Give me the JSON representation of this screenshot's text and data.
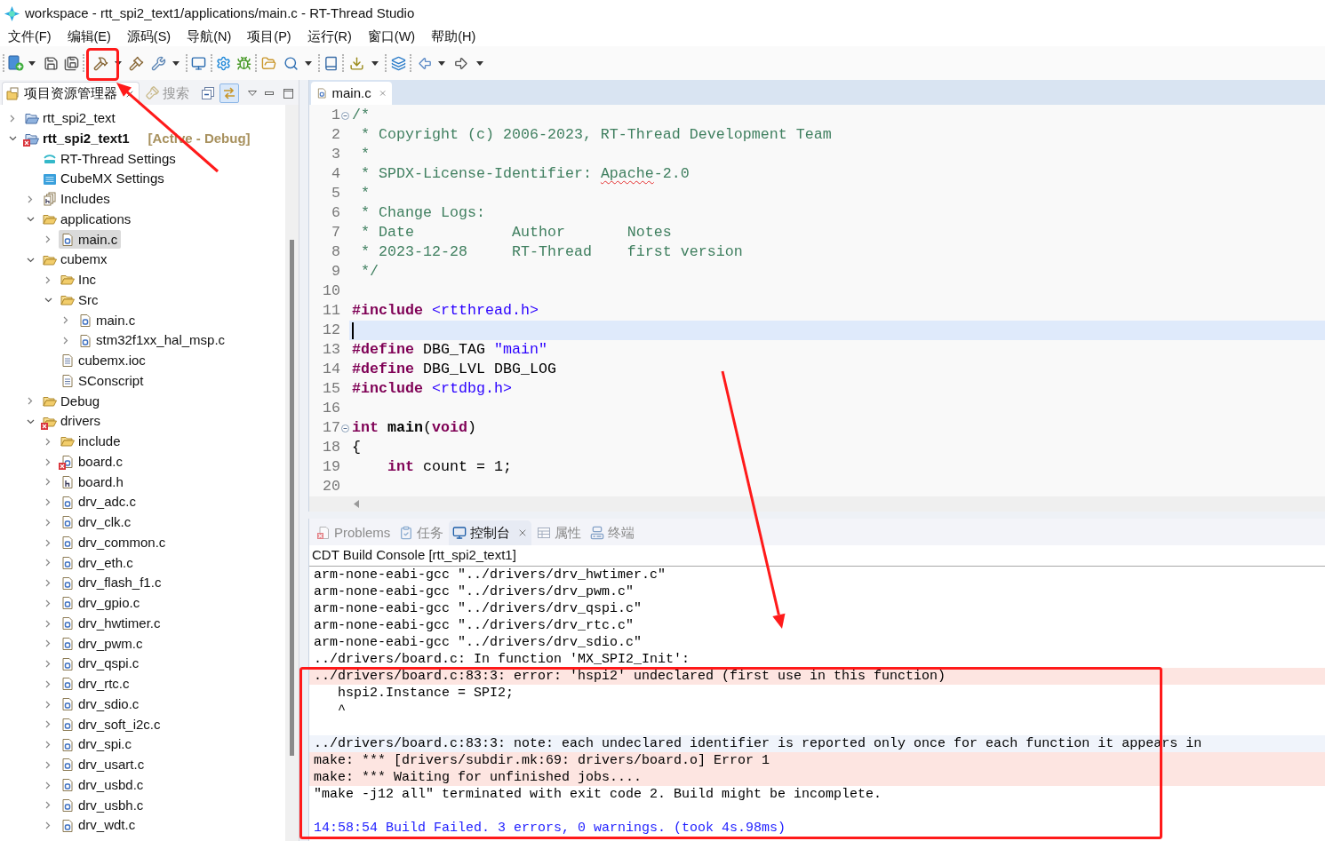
{
  "window": {
    "title": "workspace - rtt_spi2_text1/applications/main.c - RT-Thread Studio"
  },
  "menu": [
    "文件(F)",
    "编辑(E)",
    "源码(S)",
    "导航(N)",
    "项目(P)",
    "运行(R)",
    "窗口(W)",
    "帮助(H)"
  ],
  "explorer": {
    "tabs": [
      {
        "label": "项目资源管理器",
        "kind": "explorer",
        "selected": true
      },
      {
        "label": "搜索",
        "kind": "search",
        "selected": false
      }
    ],
    "link_with_editor": {
      "on": true
    },
    "tree": [
      {
        "label": "rtt_spi2_text",
        "kind": "project",
        "expanded": false,
        "selected": false,
        "error": false,
        "active": false
      },
      {
        "label": "rtt_spi2_text1",
        "kind": "project",
        "expanded": true,
        "selected": false,
        "error": true,
        "active": true,
        "tag": "[Active - Debug]",
        "children": [
          {
            "label": "RT-Thread Settings",
            "kind": "rtsettings",
            "selected": false,
            "error": false
          },
          {
            "label": "CubeMX Settings",
            "kind": "mxsettings",
            "selected": false,
            "error": false
          },
          {
            "label": "Includes",
            "kind": "includes",
            "expanded": false,
            "selected": false,
            "error": false
          },
          {
            "label": "applications",
            "kind": "folder",
            "expanded": true,
            "selected": false,
            "error": false,
            "children": [
              {
                "label": "main.c",
                "kind": "source",
                "expanded": false,
                "selected": true,
                "error": false
              }
            ]
          },
          {
            "label": "cubemx",
            "kind": "folder",
            "expanded": true,
            "selected": false,
            "error": false,
            "children": [
              {
                "label": "Inc",
                "kind": "folder",
                "expanded": false,
                "selected": false,
                "error": false
              },
              {
                "label": "Src",
                "kind": "folder",
                "expanded": true,
                "selected": false,
                "error": false,
                "children": [
                  {
                    "label": "main.c",
                    "kind": "source",
                    "expanded": false,
                    "selected": false,
                    "error": false
                  },
                  {
                    "label": "stm32f1xx_hal_msp.c",
                    "kind": "source",
                    "expanded": false,
                    "selected": false,
                    "error": false
                  }
                ]
              },
              {
                "label": "cubemx.ioc",
                "kind": "document",
                "selected": false,
                "error": false
              },
              {
                "label": "SConscript",
                "kind": "document",
                "selected": false,
                "error": false
              }
            ]
          },
          {
            "label": "Debug",
            "kind": "folder",
            "expanded": false,
            "selected": false,
            "error": false
          },
          {
            "label": "drivers",
            "kind": "folder",
            "expanded": true,
            "selected": false,
            "error": true,
            "children": [
              {
                "label": "include",
                "kind": "folder",
                "expanded": false,
                "selected": false,
                "error": false
              },
              {
                "label": "board.c",
                "kind": "source",
                "expanded": false,
                "selected": false,
                "error": true
              },
              {
                "label": "board.h",
                "kind": "header",
                "expanded": false,
                "selected": false,
                "error": false
              },
              {
                "label": "drv_adc.c",
                "kind": "source",
                "expanded": false,
                "selected": false,
                "error": false
              },
              {
                "label": "drv_clk.c",
                "kind": "source",
                "expanded": false,
                "selected": false,
                "error": false
              },
              {
                "label": "drv_common.c",
                "kind": "source",
                "expanded": false,
                "selected": false,
                "error": false
              },
              {
                "label": "drv_eth.c",
                "kind": "source",
                "expanded": false,
                "selected": false,
                "error": false
              },
              {
                "label": "drv_flash_f1.c",
                "kind": "source",
                "expanded": false,
                "selected": false,
                "error": false
              },
              {
                "label": "drv_gpio.c",
                "kind": "source",
                "expanded": false,
                "selected": false,
                "error": false
              },
              {
                "label": "drv_hwtimer.c",
                "kind": "source",
                "expanded": false,
                "selected": false,
                "error": false
              },
              {
                "label": "drv_pwm.c",
                "kind": "source",
                "expanded": false,
                "selected": false,
                "error": false
              },
              {
                "label": "drv_qspi.c",
                "kind": "source",
                "expanded": false,
                "selected": false,
                "error": false
              },
              {
                "label": "drv_rtc.c",
                "kind": "source",
                "expanded": false,
                "selected": false,
                "error": false
              },
              {
                "label": "drv_sdio.c",
                "kind": "source",
                "expanded": false,
                "selected": false,
                "error": false
              },
              {
                "label": "drv_soft_i2c.c",
                "kind": "source",
                "expanded": false,
                "selected": false,
                "error": false
              },
              {
                "label": "drv_spi.c",
                "kind": "source",
                "expanded": false,
                "selected": false,
                "error": false
              },
              {
                "label": "drv_usart.c",
                "kind": "source",
                "expanded": false,
                "selected": false,
                "error": false
              },
              {
                "label": "drv_usbd.c",
                "kind": "source",
                "expanded": false,
                "selected": false,
                "error": false
              },
              {
                "label": "drv_usbh.c",
                "kind": "source",
                "expanded": false,
                "selected": false,
                "error": false
              },
              {
                "label": "drv_wdt.c",
                "kind": "source",
                "expanded": false,
                "selected": false,
                "error": false
              }
            ]
          }
        ]
      }
    ]
  },
  "editor": {
    "tabs": [
      {
        "label": "main.c",
        "selected": true
      }
    ],
    "lines": [
      {
        "number": "1",
        "fold": true,
        "current": false,
        "tokens": [
          {
            "text": "/*",
            "kind": "comment"
          }
        ]
      },
      {
        "number": "2",
        "fold": false,
        "current": false,
        "tokens": [
          {
            "text": " * Copyright (c) 2006-2023, RT-Thread Development Team",
            "kind": "comment"
          }
        ]
      },
      {
        "number": "3",
        "fold": false,
        "current": false,
        "tokens": [
          {
            "text": " *",
            "kind": "comment"
          }
        ]
      },
      {
        "number": "4",
        "fold": false,
        "current": false,
        "tokens": [
          {
            "text": " * SPDX-License-Identifier: ",
            "kind": "comment"
          },
          {
            "text": "Apache",
            "kind": "misspelled"
          },
          {
            "text": "-2.0",
            "kind": "comment"
          }
        ]
      },
      {
        "number": "5",
        "fold": false,
        "current": false,
        "tokens": [
          {
            "text": " *",
            "kind": "comment"
          }
        ]
      },
      {
        "number": "6",
        "fold": false,
        "current": false,
        "tokens": [
          {
            "text": " * Change Logs:",
            "kind": "comment"
          }
        ]
      },
      {
        "number": "7",
        "fold": false,
        "current": false,
        "tokens": [
          {
            "text": " * Date           Author       Notes",
            "kind": "comment"
          }
        ]
      },
      {
        "number": "8",
        "fold": false,
        "current": false,
        "tokens": [
          {
            "text": " * 2023-12-28     RT-Thread    first version",
            "kind": "comment"
          }
        ]
      },
      {
        "number": "9",
        "fold": false,
        "current": false,
        "tokens": [
          {
            "text": " */",
            "kind": "comment"
          }
        ]
      },
      {
        "number": "10",
        "fold": false,
        "current": false
      },
      {
        "number": "11",
        "fold": false,
        "current": false,
        "tokens": [
          {
            "text": "#include",
            "kind": "directive"
          },
          {
            "text": " <rtthread.h>",
            "kind": "include"
          }
        ]
      },
      {
        "number": "12",
        "fold": false,
        "current": true
      },
      {
        "number": "13",
        "fold": false,
        "current": false,
        "tokens": [
          {
            "text": "#define",
            "kind": "directive"
          },
          {
            "text": " DBG_TAG ",
            "kind": "plain"
          },
          {
            "text": "\"main\"",
            "kind": "string"
          }
        ]
      },
      {
        "number": "14",
        "fold": false,
        "current": false,
        "tokens": [
          {
            "text": "#define",
            "kind": "directive"
          },
          {
            "text": " DBG_LVL DBG_LOG",
            "kind": "plain"
          }
        ]
      },
      {
        "number": "15",
        "fold": false,
        "current": false,
        "tokens": [
          {
            "text": "#include",
            "kind": "directive"
          },
          {
            "text": " <rtdbg.h>",
            "kind": "include"
          }
        ]
      },
      {
        "number": "16",
        "fold": false,
        "current": false
      },
      {
        "number": "17",
        "fold": true,
        "current": false,
        "tokens": [
          {
            "text": "int",
            "kind": "keyword"
          },
          {
            "text": " main",
            "kind": "function"
          },
          {
            "text": "(",
            "kind": "plain"
          },
          {
            "text": "void",
            "kind": "keyword"
          },
          {
            "text": ")",
            "kind": "plain"
          }
        ]
      },
      {
        "number": "18",
        "fold": false,
        "current": false,
        "tokens": [
          {
            "text": "{",
            "kind": "plain"
          }
        ]
      },
      {
        "number": "19",
        "fold": false,
        "current": false,
        "tokens": [
          {
            "text": "    int",
            "kind": "keyword"
          },
          {
            "text": " count = 1;",
            "kind": "plain"
          }
        ]
      },
      {
        "number": "20",
        "fold": false,
        "current": false
      }
    ]
  },
  "console": {
    "tabs": [
      {
        "label": "Problems",
        "kind": "problems",
        "selected": false
      },
      {
        "label": "任务",
        "kind": "tasks",
        "selected": false
      },
      {
        "label": "控制台",
        "kind": "console",
        "selected": true
      },
      {
        "label": "属性",
        "kind": "properties",
        "selected": false
      },
      {
        "label": "终端",
        "kind": "terminal",
        "selected": false
      }
    ],
    "title": "CDT Build Console [rtt_spi2_text1]",
    "lines": [
      {
        "text": "arm-none-eabi-gcc \"../drivers/drv_hwtimer.c\"",
        "kind": "plain"
      },
      {
        "text": "arm-none-eabi-gcc \"../drivers/drv_pwm.c\"",
        "kind": "plain"
      },
      {
        "text": "arm-none-eabi-gcc \"../drivers/drv_qspi.c\"",
        "kind": "plain"
      },
      {
        "text": "arm-none-eabi-gcc \"../drivers/drv_rtc.c\"",
        "kind": "plain"
      },
      {
        "text": "arm-none-eabi-gcc \"../drivers/drv_sdio.c\"",
        "kind": "plain"
      },
      {
        "text": "../drivers/board.c: In function 'MX_SPI2_Init':",
        "kind": "plain"
      },
      {
        "text": "../drivers/board.c:83:3: error: 'hspi2' undeclared (first use in this function)",
        "kind": "error"
      },
      {
        "text": "   hspi2.Instance = SPI2;",
        "kind": "plain"
      },
      {
        "text": "   ^",
        "kind": "plain"
      },
      {
        "kind": "blank"
      },
      {
        "text": "../drivers/board.c:83:3: note: each undeclared identifier is reported only once for each function it appears in",
        "kind": "note"
      },
      {
        "text": "make: *** [drivers/subdir.mk:69: drivers/board.o] Error 1",
        "kind": "error"
      },
      {
        "text": "make: *** Waiting for unfinished jobs....",
        "kind": "error"
      },
      {
        "text": "\"make -j12 all\" terminated with exit code 2. Build might be incomplete.",
        "kind": "plain"
      },
      {
        "kind": "blank"
      },
      {
        "text": "14:58:54 Build Failed. 3 errors, 0 warnings. (took 4s.98ms)",
        "kind": "status"
      }
    ]
  }
}
